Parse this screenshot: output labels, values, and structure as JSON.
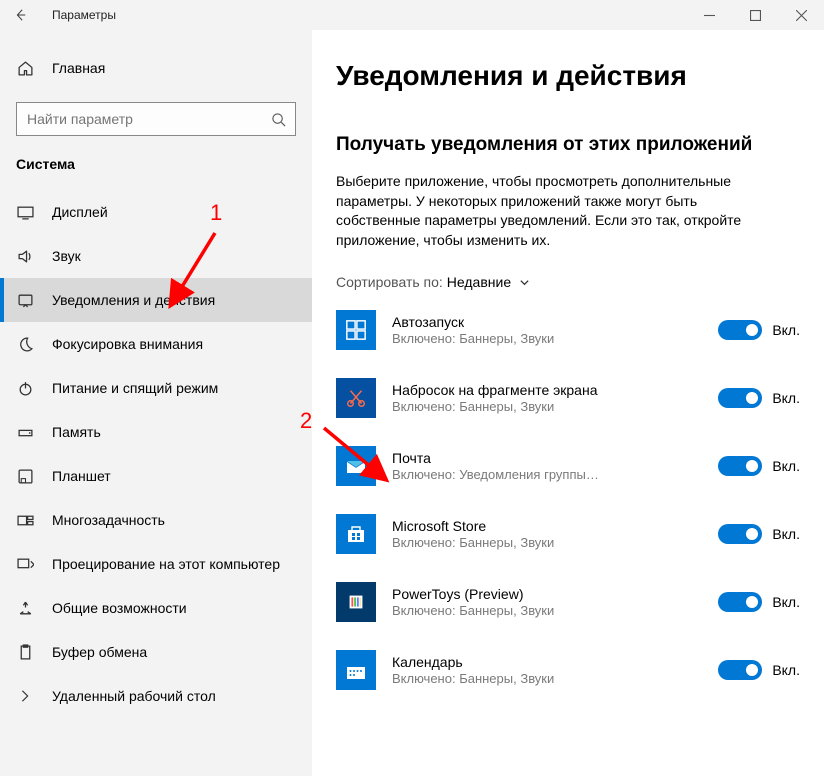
{
  "titlebar": {
    "title": "Параметры"
  },
  "sidebar": {
    "home": "Главная",
    "search_placeholder": "Найти параметр",
    "section": "Система",
    "items": [
      {
        "label": "Дисплей"
      },
      {
        "label": "Звук"
      },
      {
        "label": "Уведомления и действия"
      },
      {
        "label": "Фокусировка внимания"
      },
      {
        "label": "Питание и спящий режим"
      },
      {
        "label": "Память"
      },
      {
        "label": "Планшет"
      },
      {
        "label": "Многозадачность"
      },
      {
        "label": "Проецирование на этот компьютер"
      },
      {
        "label": "Общие возможности"
      },
      {
        "label": "Буфер обмена"
      },
      {
        "label": "Удаленный рабочий стол"
      }
    ]
  },
  "content": {
    "title": "Уведомления и действия",
    "sub": "Получать уведомления от этих приложений",
    "desc": "Выберите приложение, чтобы просмотреть дополнительные параметры. У некоторых приложений также могут быть собственные параметры уведомлений. Если это так, откройте приложение, чтобы изменить их.",
    "sort_label": "Сортировать по:",
    "sort_value": "Недавние",
    "on_label": "Вкл.",
    "apps": [
      {
        "name": "Автозапуск",
        "sub": "Включено: Баннеры, Звуки"
      },
      {
        "name": "Набросок на фрагменте экрана",
        "sub": "Включено: Баннеры, Звуки"
      },
      {
        "name": "Почта",
        "sub": "Включено: Уведомления группы…"
      },
      {
        "name": "Microsoft Store",
        "sub": "Включено: Баннеры, Звуки"
      },
      {
        "name": "PowerToys (Preview)",
        "sub": "Включено: Баннеры, Звуки"
      },
      {
        "name": "Календарь",
        "sub": "Включено: Баннеры, Звуки"
      }
    ]
  },
  "annotations": {
    "one": "1",
    "two": "2"
  }
}
